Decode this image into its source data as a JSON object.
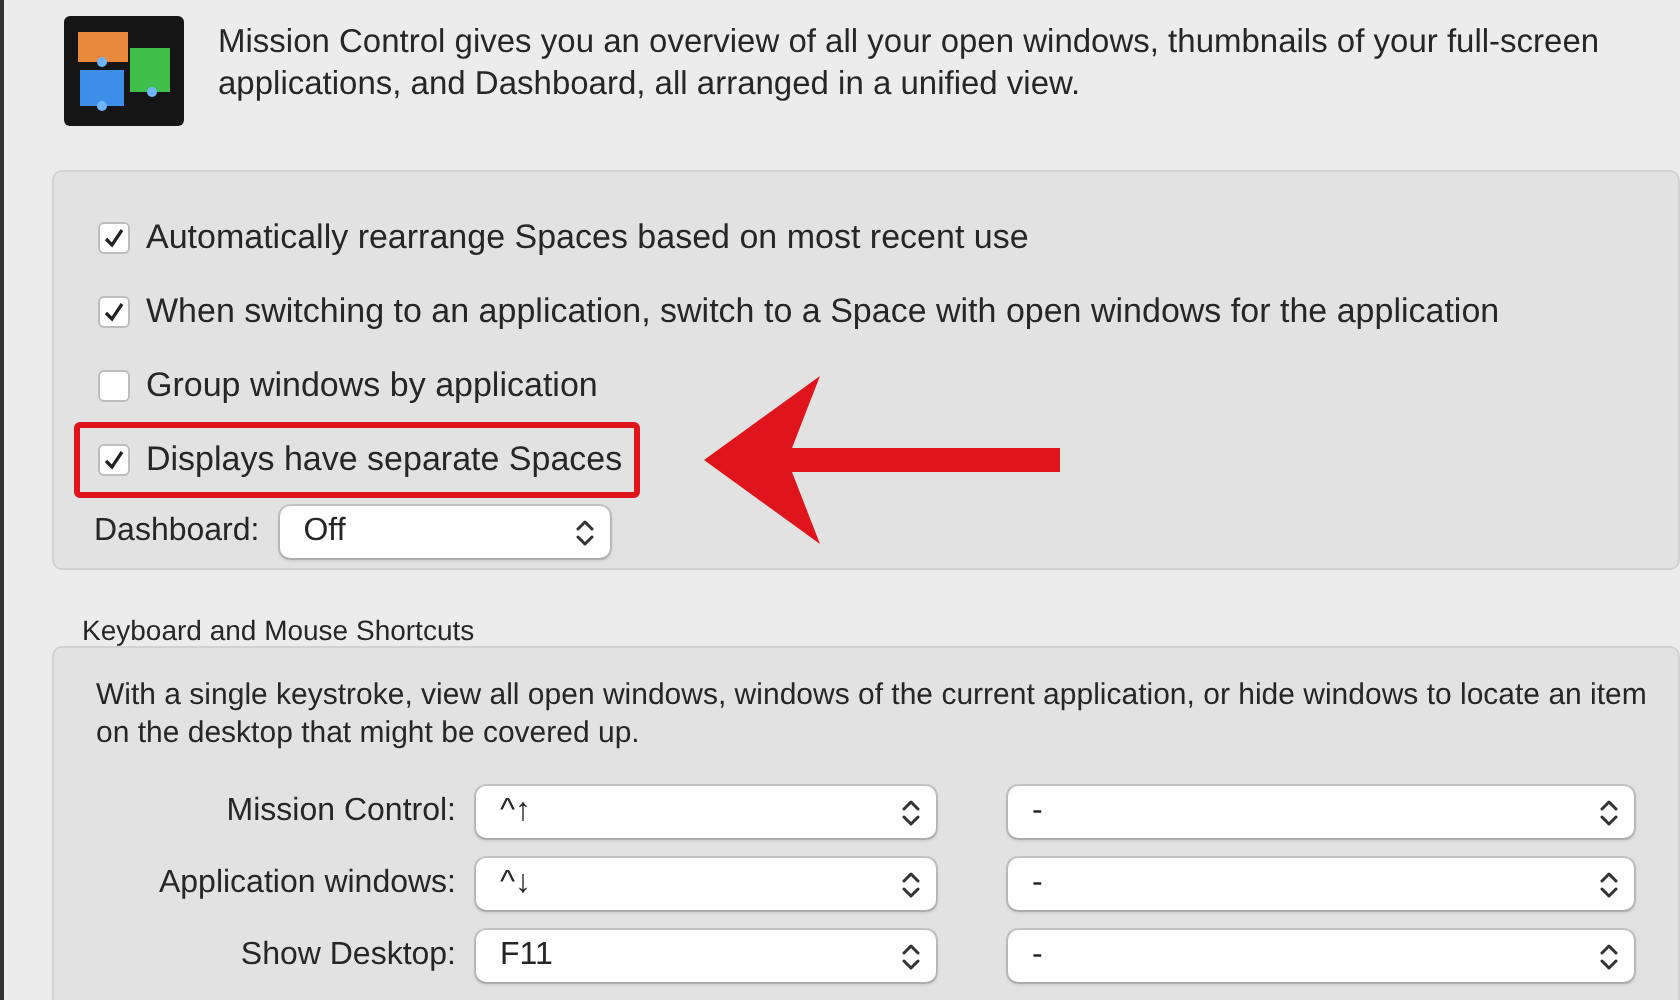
{
  "header": {
    "description": "Mission Control gives you an overview of all your open windows, thumbnails of your full-screen applications, and Dashboard, all arranged in a unified view."
  },
  "options": [
    {
      "label": "Automatically rearrange Spaces based on most recent use",
      "checked": true,
      "highlighted": false
    },
    {
      "label": "When switching to an application, switch to a Space with open windows for the application",
      "checked": true,
      "highlighted": false
    },
    {
      "label": "Group windows by application",
      "checked": false,
      "highlighted": false
    },
    {
      "label": "Displays have separate Spaces",
      "checked": true,
      "highlighted": true
    }
  ],
  "dashboard": {
    "label": "Dashboard:",
    "value": "Off"
  },
  "shortcuts": {
    "title": "Keyboard and Mouse Shortcuts",
    "description": "With a single keystroke, view all open windows, windows of the current application, or hide windows to locate an item on the desktop that might be covered up.",
    "rows": [
      {
        "label": "Mission Control:",
        "keyboard": "^↑",
        "mouse": "-"
      },
      {
        "label": "Application windows:",
        "keyboard": "^↓",
        "mouse": "-"
      },
      {
        "label": "Show Desktop:",
        "keyboard": "F11",
        "mouse": "-"
      }
    ]
  }
}
